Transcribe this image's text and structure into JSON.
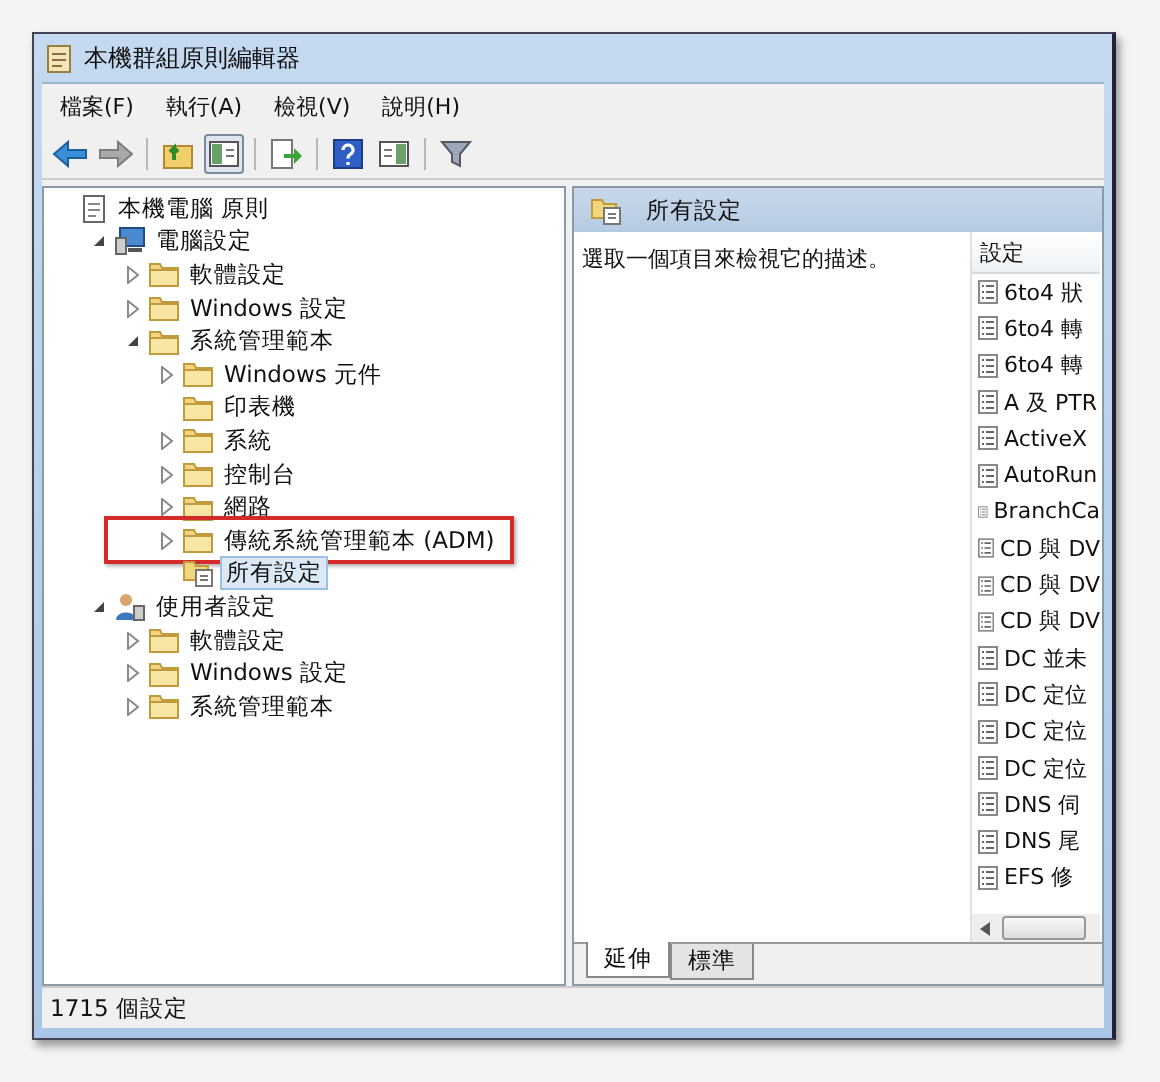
{
  "window": {
    "title": "本機群組原則編輯器"
  },
  "menu": [
    "檔案(F)",
    "執行(A)",
    "檢視(V)",
    "說明(H)"
  ],
  "toolbar": [
    {
      "kind": "back",
      "pressed": false
    },
    {
      "kind": "forward",
      "pressed": false
    },
    {
      "kind": "sep"
    },
    {
      "kind": "up",
      "pressed": false
    },
    {
      "kind": "tree",
      "pressed": true
    },
    {
      "kind": "sep"
    },
    {
      "kind": "export",
      "pressed": false
    },
    {
      "kind": "sep"
    },
    {
      "kind": "help",
      "pressed": false
    },
    {
      "kind": "view",
      "pressed": false
    },
    {
      "kind": "sep"
    },
    {
      "kind": "filter",
      "pressed": false
    }
  ],
  "tree": [
    {
      "label": "本機電腦 原則",
      "kind": "root",
      "selected": false,
      "annotated": false,
      "children": [
        {
          "label": "電腦設定",
          "kind": "computer",
          "expanded": true,
          "selected": false,
          "annotated": false,
          "children": [
            {
              "label": "軟體設定",
              "kind": "folder",
              "expanded": false,
              "selected": false,
              "annotated": false
            },
            {
              "label": "Windows 設定",
              "kind": "folder",
              "expanded": false,
              "selected": false,
              "annotated": false
            },
            {
              "label": "系統管理範本",
              "kind": "folder",
              "expanded": true,
              "selected": false,
              "annotated": false,
              "children": [
                {
                  "label": "Windows 元件",
                  "kind": "folder",
                  "expanded": false,
                  "selected": false,
                  "annotated": false
                },
                {
                  "label": "印表機",
                  "kind": "folder",
                  "selected": false,
                  "annotated": false
                },
                {
                  "label": "系統",
                  "kind": "folder",
                  "expanded": false,
                  "selected": false,
                  "annotated": false
                },
                {
                  "label": "控制台",
                  "kind": "folder",
                  "expanded": false,
                  "selected": false,
                  "annotated": false
                },
                {
                  "label": "網路",
                  "kind": "folder",
                  "expanded": false,
                  "selected": false,
                  "annotated": false
                },
                {
                  "label": "傳統系統管理範本 (ADM)",
                  "kind": "folder",
                  "expanded": false,
                  "selected": false,
                  "annotated": true
                },
                {
                  "label": "所有設定",
                  "kind": "settings",
                  "selected": true,
                  "annotated": false
                }
              ]
            }
          ]
        },
        {
          "label": "使用者設定",
          "kind": "user",
          "expanded": true,
          "selected": false,
          "annotated": false,
          "children": [
            {
              "label": "軟體設定",
              "kind": "folder",
              "expanded": false,
              "selected": false,
              "annotated": false
            },
            {
              "label": "Windows 設定",
              "kind": "folder",
              "expanded": false,
              "selected": false,
              "annotated": false
            },
            {
              "label": "系統管理範本",
              "kind": "folder",
              "expanded": false,
              "selected": false,
              "annotated": false
            }
          ]
        }
      ]
    }
  ],
  "details": {
    "title": "所有設定",
    "description": "選取一個項目來檢視它的描述。",
    "column": "設定",
    "rows": [
      "6to4 狀",
      "6to4 轉",
      "6to4 轉",
      "A 及 PTR",
      "ActiveX",
      "AutoRun",
      "BranchCa",
      "CD 與 DV",
      "CD 與 DV",
      "CD 與 DV",
      "DC 並未",
      "DC 定位",
      "DC 定位",
      "DC 定位",
      "DNS 伺",
      "DNS 尾",
      "EFS 修"
    ]
  },
  "tabs": [
    {
      "label": "延伸",
      "selected": true
    },
    {
      "label": "標準",
      "selected": false
    }
  ],
  "status_bar": "1715 個設定"
}
